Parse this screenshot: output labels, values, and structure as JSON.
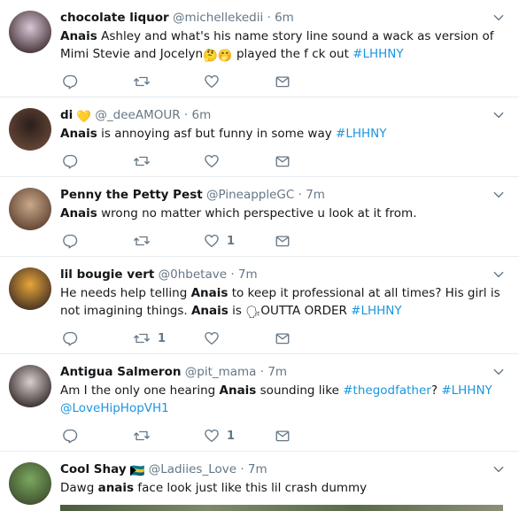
{
  "tweets": [
    {
      "name": "chocolate liquor",
      "handle": "@michellekedii",
      "time": "6m",
      "segments": [
        {
          "t": "Anais",
          "b": true
        },
        {
          "t": " Ashley and what's his name story line sound a wack as version of  Mimi Stevie and Jocelyn"
        },
        {
          "t": "🤔🤭",
          "emoji": true
        },
        {
          "t": " played the f  ck out "
        },
        {
          "t": "#LHHNY",
          "tag": true
        }
      ],
      "likes": "",
      "retweets": "",
      "avatar_colors": [
        "#d9c7d6",
        "#3b2a2e"
      ]
    },
    {
      "name": "di",
      "name_badge": "💛",
      "handle": "@_deeAMOUR",
      "time": "6m",
      "segments": [
        {
          "t": "Anais",
          "b": true
        },
        {
          "t": " is annoying asf but funny in some way "
        },
        {
          "t": "#LHHNY",
          "tag": true
        }
      ],
      "likes": "",
      "retweets": "",
      "avatar_colors": [
        "#2a1e1a",
        "#6b4a3a"
      ]
    },
    {
      "name": "Penny the Petty Pest",
      "handle": "@PineappleGC",
      "time": "7m",
      "segments": [
        {
          "t": "Anais",
          "b": true
        },
        {
          "t": " wrong no matter which perspective u look at it from."
        }
      ],
      "likes": "1",
      "retweets": "",
      "avatar_colors": [
        "#c9a98a",
        "#5a3d2c"
      ]
    },
    {
      "name": "lil bougie vert",
      "handle": "@0hbetave",
      "time": "7m",
      "segments": [
        {
          "t": "He needs help telling "
        },
        {
          "t": "Anais",
          "b": true
        },
        {
          "t": " to keep it professional at all times? His girl is not imagining things. "
        },
        {
          "t": "Anais",
          "b": true
        },
        {
          "t": " is "
        },
        {
          "t": "🗣",
          "emoji": true
        },
        {
          "t": "OUTTA ORDER "
        },
        {
          "t": "#LHHNY",
          "tag": true
        }
      ],
      "likes": "",
      "retweets": "1",
      "avatar_colors": [
        "#e8a53a",
        "#3a2a22"
      ]
    },
    {
      "name": "Antigua Salmeron",
      "handle": "@pit_mama",
      "time": "7m",
      "segments": [
        {
          "t": "Am I the only one hearing "
        },
        {
          "t": "Anais",
          "b": true
        },
        {
          "t": " sounding like "
        },
        {
          "t": "#thegodfather",
          "tag": true
        },
        {
          "t": "? "
        },
        {
          "t": "#LHHNY",
          "tag": true
        },
        {
          "t": " "
        },
        {
          "t": "@LoveHipHopVH1",
          "tag": true
        }
      ],
      "likes": "1",
      "retweets": "",
      "avatar_colors": [
        "#d8d0cc",
        "#2b2222"
      ]
    },
    {
      "name": "Cool Shay",
      "name_badge": "🇧🇸",
      "handle": "@Ladiies_Love",
      "time": "7m",
      "segments": [
        {
          "t": "Dawg "
        },
        {
          "t": "anais",
          "b": true
        },
        {
          "t": " face look just like this lil crash dummy"
        }
      ],
      "likes": "",
      "retweets": "",
      "avatar_colors": [
        "#7aa860",
        "#3d4a2c"
      ]
    }
  ],
  "colors": {
    "accent": "#1b95e0",
    "muted": "#657786",
    "text": "#14171a",
    "divider": "#e6ecf0"
  },
  "icons": [
    "reply-icon",
    "retweet-icon",
    "like-icon",
    "dm-icon",
    "chevron-down-icon"
  ]
}
